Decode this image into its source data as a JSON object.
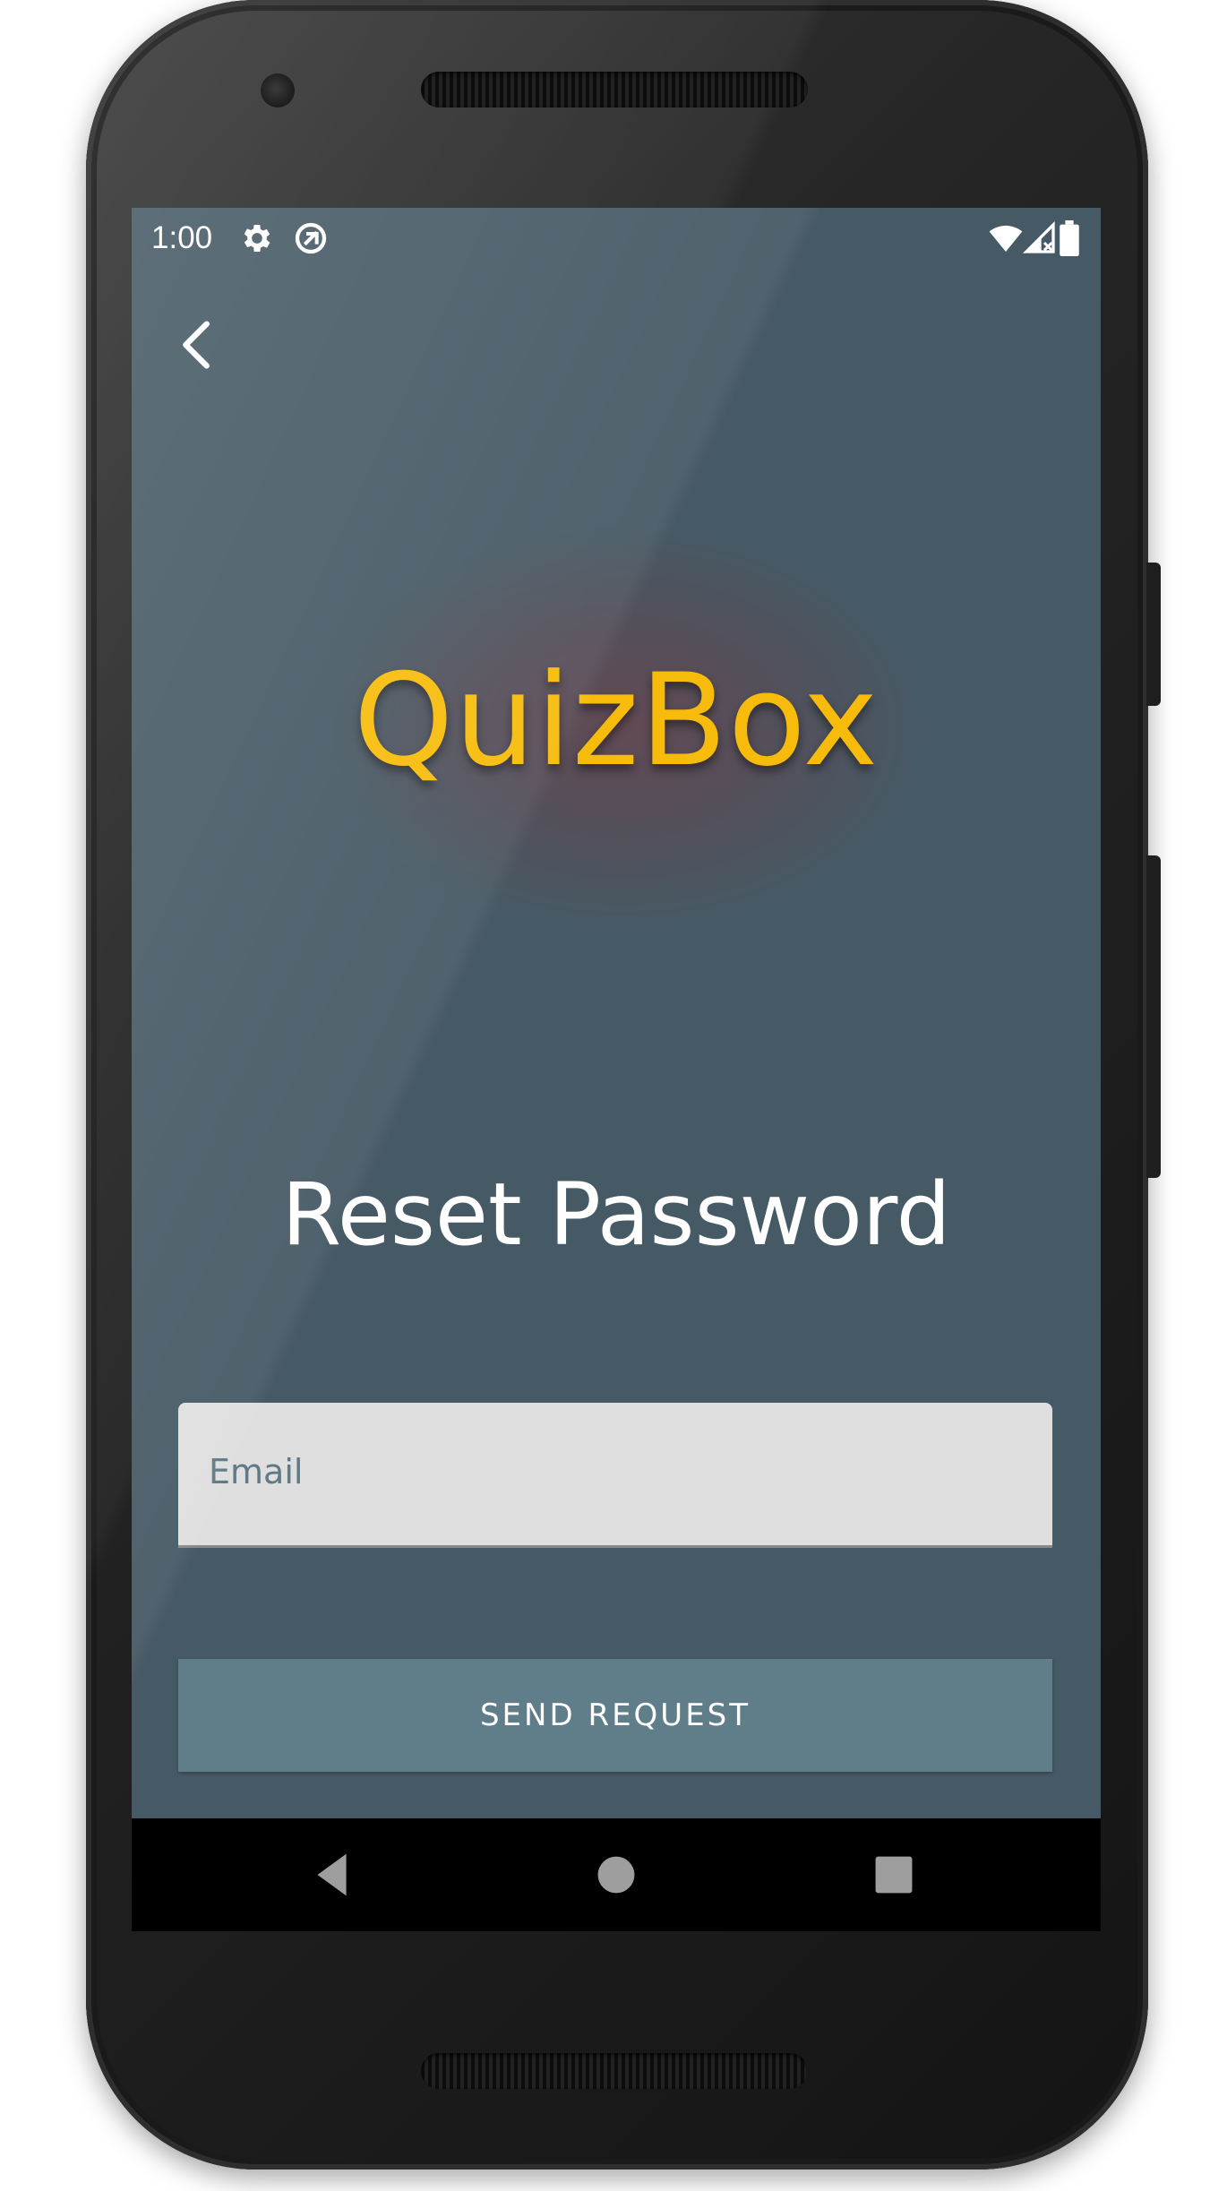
{
  "status_bar": {
    "time": "1:00",
    "left_icons": [
      "gear-icon",
      "vpn-icon"
    ],
    "right_icons": [
      "wifi-icon",
      "signal-icon",
      "battery-icon"
    ]
  },
  "header": {
    "back_icon": "chevron-left-icon"
  },
  "logo": {
    "text": "QuizBox",
    "color": "#f7bc0b"
  },
  "page": {
    "title": "Reset Password"
  },
  "form": {
    "email": {
      "placeholder": "Email",
      "value": ""
    },
    "submit_label": "SEND REQUEST"
  },
  "nav_bar": {
    "icons": [
      "back-triangle-icon",
      "home-circle-icon",
      "recents-square-icon"
    ]
  },
  "colors": {
    "background": "#465a65",
    "field": "#dfdfdf",
    "button": "#607d8a",
    "accent": "#f7bc0b"
  }
}
